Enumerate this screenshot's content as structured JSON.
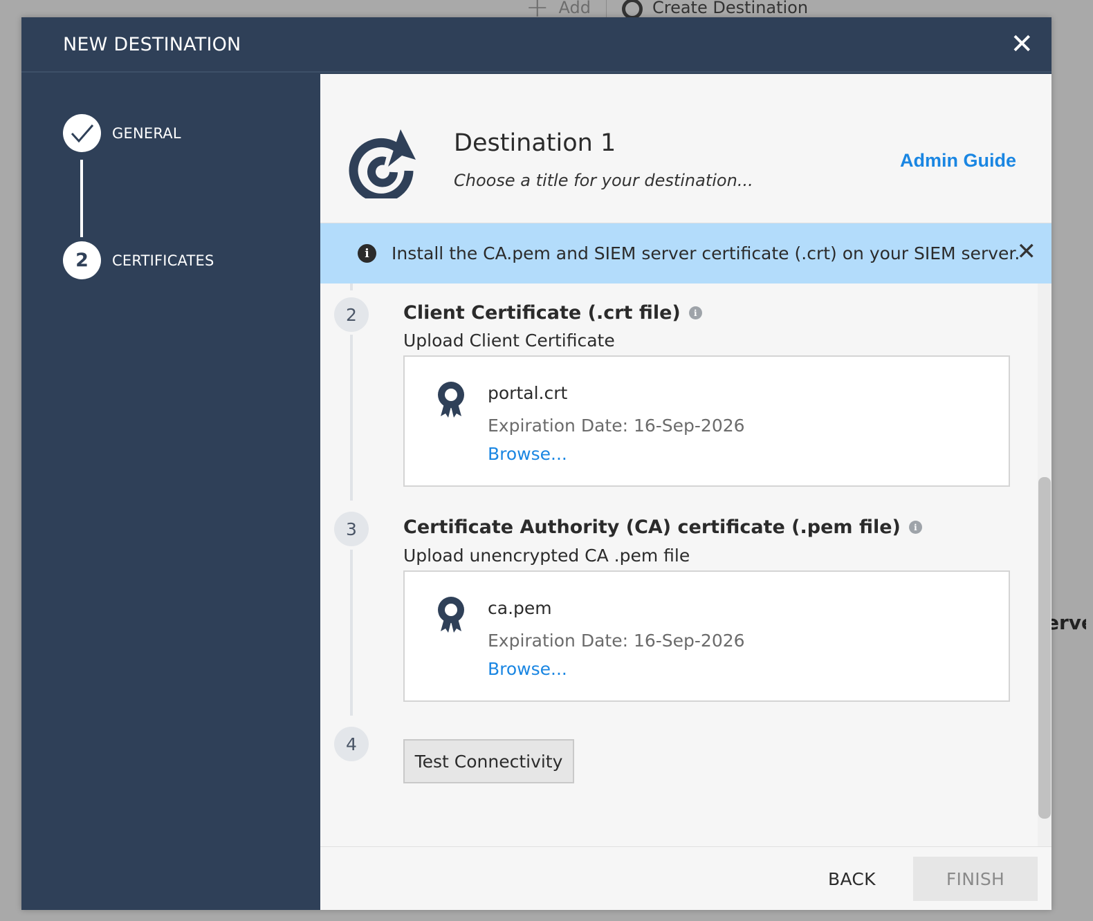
{
  "background": {
    "add_label": "Add",
    "create_destination_label": "Create Destination",
    "peek_text": "erve"
  },
  "modal": {
    "title": "NEW DESTINATION",
    "close_glyph": "✕"
  },
  "sidebar": {
    "steps": [
      {
        "label": "GENERAL",
        "state": "completed",
        "marker": "✓"
      },
      {
        "label": "CERTIFICATES",
        "state": "active",
        "marker": "2"
      }
    ]
  },
  "destination": {
    "name": "Destination 1",
    "subtitle": "Choose a title for your destination...",
    "admin_guide_label": "Admin Guide"
  },
  "info_banner": {
    "icon_glyph": "i",
    "text": "Install the CA.pem and SIEM server certificate (.crt) on your SIEM server.",
    "close_glyph": "✕"
  },
  "sections": {
    "client_cert": {
      "number": "2",
      "title": "Client Certificate (.crt file)",
      "info_glyph": "i",
      "subtitle": "Upload Client Certificate",
      "file_name": "portal.crt",
      "expiration": "Expiration Date: 16-Sep-2026",
      "browse_label": "Browse..."
    },
    "ca_cert": {
      "number": "3",
      "title": "Certificate Authority (CA) certificate (.pem file)",
      "info_glyph": "i",
      "subtitle": "Upload unencrypted CA .pem file",
      "file_name": "ca.pem",
      "expiration": "Expiration Date: 16-Sep-2026",
      "browse_label": "Browse..."
    },
    "test": {
      "number": "4",
      "button_label": "Test Connectivity"
    }
  },
  "footer": {
    "back_label": "BACK",
    "finish_label": "FINISH"
  },
  "colors": {
    "navy": "#2f4058",
    "link_blue": "#1a86e2",
    "banner_blue": "#b3dcfb"
  }
}
